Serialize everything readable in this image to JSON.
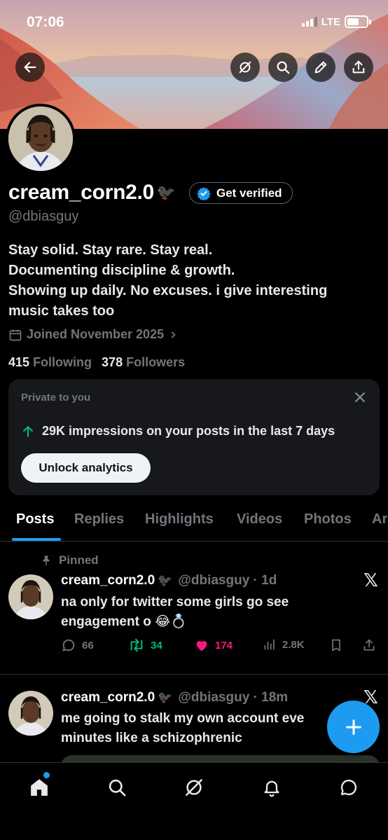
{
  "status_bar": {
    "time": "07:06",
    "network": "LTE"
  },
  "header_buttons": [
    "back-arrow-icon",
    "grok-icon",
    "search-icon",
    "edit-pencil-icon",
    "share-icon"
  ],
  "profile": {
    "display_name": "cream_corn2.0",
    "name_emoji": "🐦‍⬛",
    "get_verified_label": "Get verified",
    "handle": "@dbiasguy",
    "bio_lines": [
      "Stay solid. Stay rare. Stay real.",
      "Documenting discipline & growth.",
      "Showing up daily. No excuses. i give interesting",
      "music takes too"
    ],
    "joined": "Joined November 2025",
    "following_count": "415",
    "following_label": "Following",
    "followers_count": "378",
    "followers_label": "Followers"
  },
  "private_card": {
    "title": "Private to you",
    "impressions_text": "29K impressions on your posts in the last 7 days",
    "unlock_label": "Unlock analytics"
  },
  "tabs": [
    {
      "label": "Posts",
      "active": true
    },
    {
      "label": "Replies"
    },
    {
      "label": "Highlights"
    },
    {
      "label": "Videos"
    },
    {
      "label": "Photos"
    },
    {
      "label": "Ar"
    }
  ],
  "posts": [
    {
      "pinned_label": "Pinned",
      "name": "cream_corn2.0",
      "handle_time": "@dbiasguy · 1d",
      "text_lines": [
        "na only for twitter some girls go see",
        "engagement o 😂💍"
      ],
      "replies": "66",
      "reposts": "34",
      "likes": "174",
      "views": "2.8K"
    },
    {
      "name": "cream_corn2.0",
      "handle_time": "@dbiasguy · 18m",
      "text_lines": [
        "me going to stalk my own account eve",
        "minutes like a schizophrenic"
      ]
    }
  ],
  "colors": {
    "accent": "#1d9bf0",
    "repost": "#00ba7c",
    "like": "#f91880",
    "muted": "#71767b"
  },
  "bottom_nav": [
    "home-icon",
    "search-icon",
    "grok-icon",
    "notifications-icon",
    "messages-icon"
  ]
}
